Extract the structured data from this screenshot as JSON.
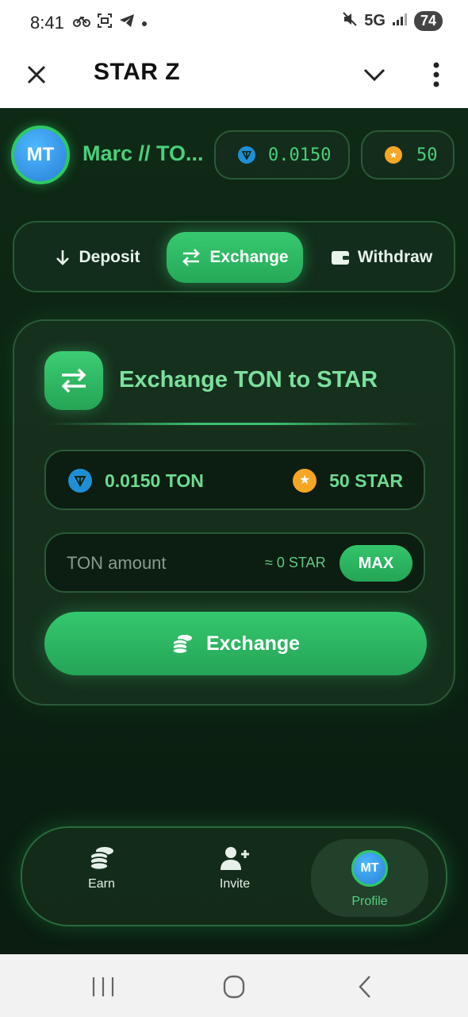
{
  "status_bar": {
    "time": "8:41",
    "network": "5G",
    "battery": "74"
  },
  "title_bar": {
    "title": "STAR Z"
  },
  "header": {
    "avatar_initials": "MT",
    "user_name": "Marc // TO...",
    "ton_balance": "0.0150",
    "star_balance": "50"
  },
  "tabs": [
    {
      "label": "Deposit",
      "icon": "arrow-down-icon",
      "active": false
    },
    {
      "label": "Exchange",
      "icon": "swap-icon",
      "active": true
    },
    {
      "label": "Withdraw",
      "icon": "wallet-icon",
      "active": false
    }
  ],
  "exchange_card": {
    "title": "Exchange TON to STAR",
    "ton_balance": "0.0150 TON",
    "star_balance": "50 STAR",
    "amount_placeholder": "TON amount",
    "approx_text": "≈ 0 STAR",
    "max_label": "MAX",
    "submit_label": "Exchange"
  },
  "bottom_nav": [
    {
      "label": "Earn",
      "icon": "coins-icon"
    },
    {
      "label": "Invite",
      "icon": "add-user-icon"
    },
    {
      "label": "Profile",
      "icon": "avatar",
      "active": true,
      "avatar_initials": "MT"
    }
  ],
  "colors": {
    "accent": "#2fc864",
    "text_green": "#4ad07a",
    "background": "#0c2313",
    "ton": "#1e8fd6",
    "star": "#f5a623"
  }
}
